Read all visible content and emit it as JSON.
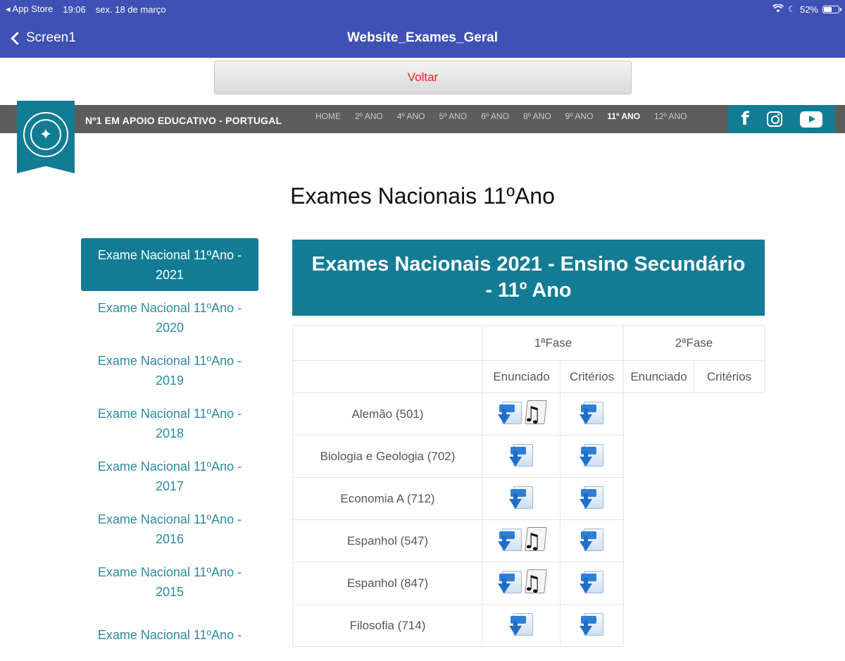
{
  "status_bar": {
    "back_app": "◂ App Store",
    "time": "19:06",
    "date": "sex. 18 de março",
    "battery": "52%"
  },
  "nav": {
    "back_label": "Screen1",
    "title": "Website_Exames_Geral"
  },
  "voltar_label": "Voltar",
  "site": {
    "tagline": "Nº1 EM APOIO EDUCATIVO - PORTUGAL",
    "menu": [
      "HOME",
      "2º ANO",
      "4º ANO",
      "5º ANO",
      "6º ANO",
      "8º ANO",
      "9º ANO",
      "11º ANO",
      "12º ANO"
    ],
    "menu_active": "11º ANO"
  },
  "page_title": "Exames Nacionais 11ºAno",
  "sidebar": {
    "items": [
      "Exame Nacional 11ºAno - 2021",
      "Exame Nacional 11ºAno - 2020",
      "Exame Nacional 11ºAno - 2019",
      "Exame Nacional 11ºAno - 2018",
      "Exame Nacional 11ºAno - 2017",
      "Exame Nacional 11ºAno - 2016",
      "Exame Nacional 11ºAno - 2015",
      "Exame Nacional 11ºAno -"
    ],
    "active_index": 0
  },
  "banner": "Exames Nacionais 2021 - Ensino Secundário - 11º Ano",
  "table": {
    "phase1": "1ªFase",
    "phase2": "2ªFase",
    "sub_headers": [
      "Enunciado",
      "Critérios",
      "Enunciado",
      "Critérios"
    ],
    "rows": [
      {
        "subject": "Alemão (501)",
        "audio": true
      },
      {
        "subject": "Biologia e Geologia (702)",
        "audio": false
      },
      {
        "subject": "Economia A (712)",
        "audio": false
      },
      {
        "subject": "Espanhol (547)",
        "audio": true
      },
      {
        "subject": "Espanhol (847)",
        "audio": true
      },
      {
        "subject": "Filosofia (714)",
        "audio": false
      }
    ]
  },
  "colors": {
    "app_bar": "#3f51b5",
    "brand_teal": "#127c95",
    "voltar_text": "#e0202a"
  }
}
